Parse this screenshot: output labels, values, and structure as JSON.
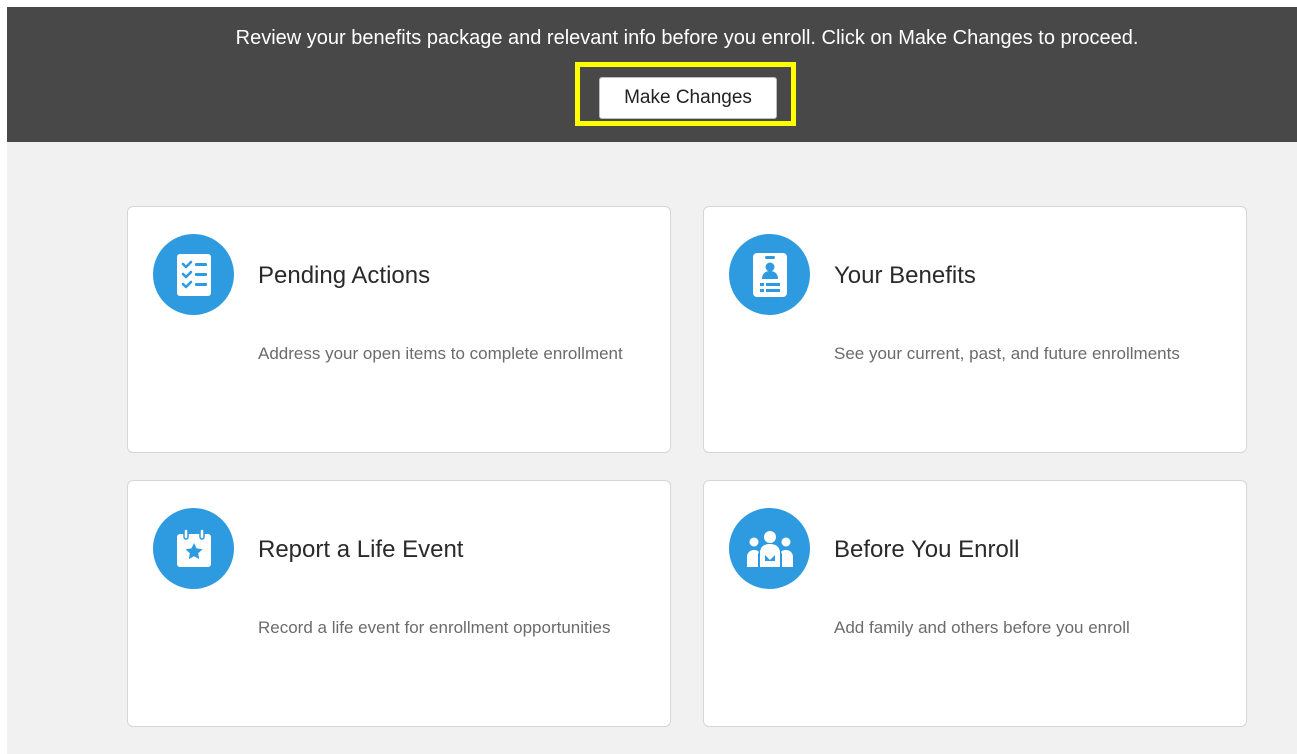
{
  "banner": {
    "message": "Review your benefits package and relevant info before you enroll. Click on Make Changes to proceed.",
    "button_label": "Make Changes"
  },
  "cards": [
    {
      "title": "Pending Actions",
      "description": "Address your open items to complete enrollment",
      "icon": "checklist-icon"
    },
    {
      "title": "Your Benefits",
      "description": "See your current, past, and future enrollments",
      "icon": "id-badge-icon"
    },
    {
      "title": "Report a Life Event",
      "description": "Record a life event for enrollment opportunities",
      "icon": "calendar-star-icon"
    },
    {
      "title": "Before You Enroll",
      "description": "Add family and others before you enroll",
      "icon": "family-group-icon"
    }
  ],
  "colors": {
    "banner_bg": "#484848",
    "highlight": "#ffff00",
    "icon_bg": "#2e9be0",
    "content_bg": "#f1f1f1"
  }
}
